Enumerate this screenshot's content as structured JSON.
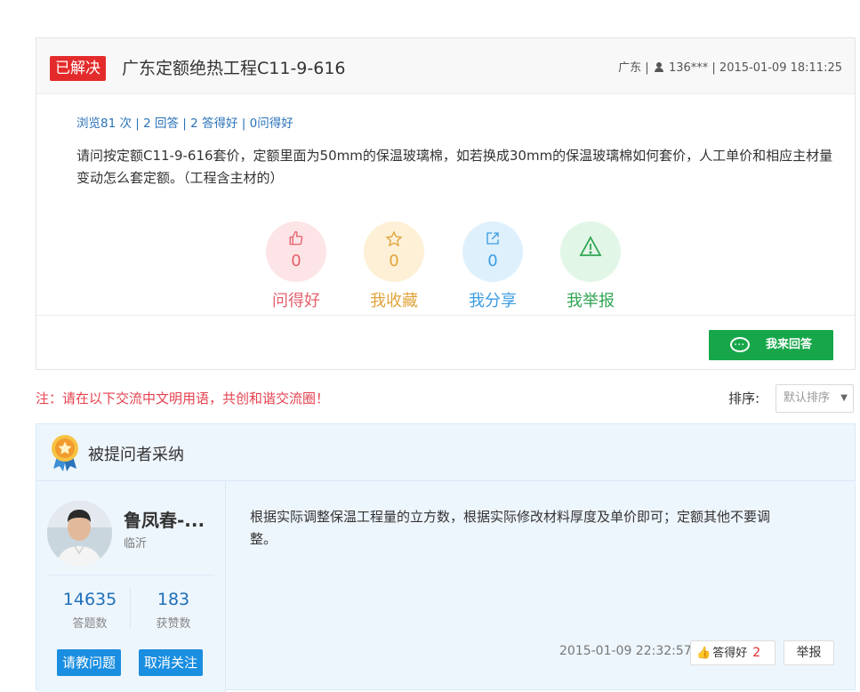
{
  "question": {
    "status_badge": "已解决",
    "title": "广东定额绝热工程C11-9-616",
    "meta": {
      "region": "广东",
      "user": "136***",
      "datetime": "2015-01-09 18:11:25"
    },
    "stats": "浏览81 次 | 2 回答 | 2 答得好 | 0问得好",
    "body": "请问按定额C11-9-616套价，定额里面为50mm的保温玻璃棉，如若换成30mm的保温玻璃棉如何套价，人工单价和相应主材量变动怎么套定额。（工程含主材的）",
    "actions": [
      {
        "label": "问得好",
        "count": "0",
        "icon": "thumbs-up-icon"
      },
      {
        "label": "我收藏",
        "count": "0",
        "icon": "star-icon"
      },
      {
        "label": "我分享",
        "count": "0",
        "icon": "share-icon"
      },
      {
        "label": "我举报",
        "count": "",
        "icon": "warning-icon"
      }
    ],
    "answer_button": "我来回答"
  },
  "notice": "注：请在以下交流中文明用语，共创和谐交流圈！",
  "sort": {
    "label": "排序:",
    "selected": "默认排序"
  },
  "adopted": {
    "title": "被提问者采纳",
    "user": {
      "name": "鲁凤春-...",
      "location": "临沂",
      "answers_count": "14635",
      "answers_label": "答题数",
      "likes_count": "183",
      "likes_label": "获赞数",
      "ask_button": "请教问题",
      "unfollow_button": "取消关注"
    },
    "answer": {
      "text": "根据实际调整保温工程量的立方数，根据实际修改材料厚度及单价即可；定额其他不要调整。",
      "time": "2015-01-09 22:32:57",
      "good_label": "答得好",
      "good_count": "2",
      "report_label": "举报"
    }
  },
  "colors": {
    "solved_badge": "#e42b2b",
    "link_blue": "#2a72b8",
    "answer_green": "#17a74a",
    "notice_red": "#e4424f",
    "adopted_bg": "#eef6fd"
  }
}
